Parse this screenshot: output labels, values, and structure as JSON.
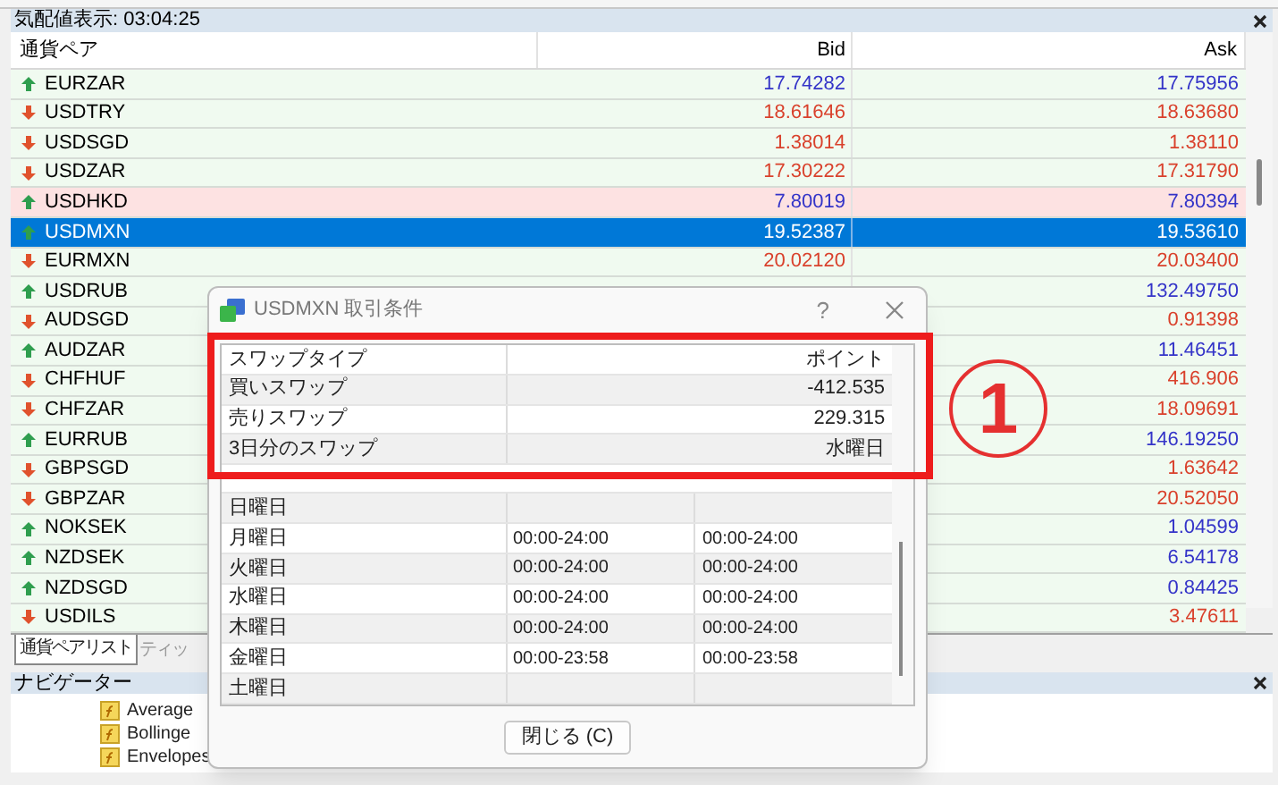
{
  "market_watch": {
    "title": "気配値表示: 03:04:25",
    "columns": [
      "通貨ペア",
      "Bid",
      "Ask"
    ],
    "rows": [
      {
        "symbol": "EURZAR",
        "rising": true,
        "bid": "17.74282",
        "ask": "17.75956",
        "selected": false,
        "flagged": false
      },
      {
        "symbol": "USDTRY",
        "rising": false,
        "bid": "18.61646",
        "ask": "18.63680",
        "selected": false,
        "flagged": false
      },
      {
        "symbol": "USDSGD",
        "rising": false,
        "bid": "1.38014",
        "ask": "1.38110",
        "selected": false,
        "flagged": false
      },
      {
        "symbol": "USDZAR",
        "rising": false,
        "bid": "17.30222",
        "ask": "17.31790",
        "selected": false,
        "flagged": false
      },
      {
        "symbol": "USDHKD",
        "rising": true,
        "bid": "7.80019",
        "ask": "7.80394",
        "selected": false,
        "flagged": true
      },
      {
        "symbol": "USDMXN",
        "rising": true,
        "bid": "19.52387",
        "ask": "19.53610",
        "selected": true,
        "flagged": false
      },
      {
        "symbol": "EURMXN",
        "rising": false,
        "bid": "20.02120",
        "ask": "20.03400",
        "selected": false,
        "flagged": false
      },
      {
        "symbol": "USDRUB",
        "rising": true,
        "ask": "132.49750",
        "selected": false,
        "flagged": false
      },
      {
        "symbol": "AUDSGD",
        "rising": false,
        "ask": "0.91398",
        "selected": false,
        "flagged": false
      },
      {
        "symbol": "AUDZAR",
        "rising": true,
        "ask": "11.46451",
        "selected": false,
        "flagged": false
      },
      {
        "symbol": "CHFHUF",
        "rising": false,
        "ask": "416.906",
        "selected": false,
        "flagged": false
      },
      {
        "symbol": "CHFZAR",
        "rising": false,
        "ask": "18.09691",
        "selected": false,
        "flagged": false
      },
      {
        "symbol": "EURRUB",
        "rising": true,
        "ask": "146.19250",
        "selected": false,
        "flagged": false
      },
      {
        "symbol": "GBPSGD",
        "rising": false,
        "ask": "1.63642",
        "selected": false,
        "flagged": false
      },
      {
        "symbol": "GBPZAR",
        "rising": false,
        "ask": "20.52050",
        "selected": false,
        "flagged": false
      },
      {
        "symbol": "NOKSEK",
        "rising": true,
        "ask": "1.04599",
        "selected": false,
        "flagged": false
      },
      {
        "symbol": "NZDSEK",
        "rising": true,
        "ask": "6.54178",
        "selected": false,
        "flagged": false
      },
      {
        "symbol": "NZDSGD",
        "rising": true,
        "ask": "0.84425",
        "selected": false,
        "flagged": false
      },
      {
        "symbol": "USDILS",
        "rising": false,
        "ask": "3.47611",
        "selected": false,
        "flagged": false
      }
    ],
    "tabs": [
      {
        "label": "通貨ペアリスト",
        "selected": true
      },
      {
        "label": "ティッ",
        "selected": false
      }
    ]
  },
  "navigator": {
    "title": "ナビゲーター",
    "items": [
      "Average",
      "Bollinge",
      "Envelopes"
    ]
  },
  "dialog": {
    "title": "USDMXN 取引条件",
    "help": "?",
    "swap_rows": [
      {
        "label": "スワップタイプ",
        "value": "ポイント"
      },
      {
        "label": "買いスワップ",
        "value": "-412.535"
      },
      {
        "label": "売りスワップ",
        "value": "229.315"
      },
      {
        "label": "3日分のスワップ",
        "value": "水曜日"
      }
    ],
    "schedule_rows": [
      {
        "day": "日曜日"
      },
      {
        "day": "月曜日",
        "quotes": "00:00-24:00",
        "trades": "00:00-24:00"
      },
      {
        "day": "火曜日",
        "quotes": "00:00-24:00",
        "trades": "00:00-24:00"
      },
      {
        "day": "水曜日",
        "quotes": "00:00-24:00",
        "trades": "00:00-24:00"
      },
      {
        "day": "木曜日",
        "quotes": "00:00-24:00",
        "trades": "00:00-24:00"
      },
      {
        "day": "金曜日",
        "quotes": "00:00-23:58",
        "trades": "00:00-23:58"
      },
      {
        "day": "土曜日"
      }
    ],
    "close_button": "閉じる (C)"
  },
  "annotation": {
    "label": "1"
  }
}
